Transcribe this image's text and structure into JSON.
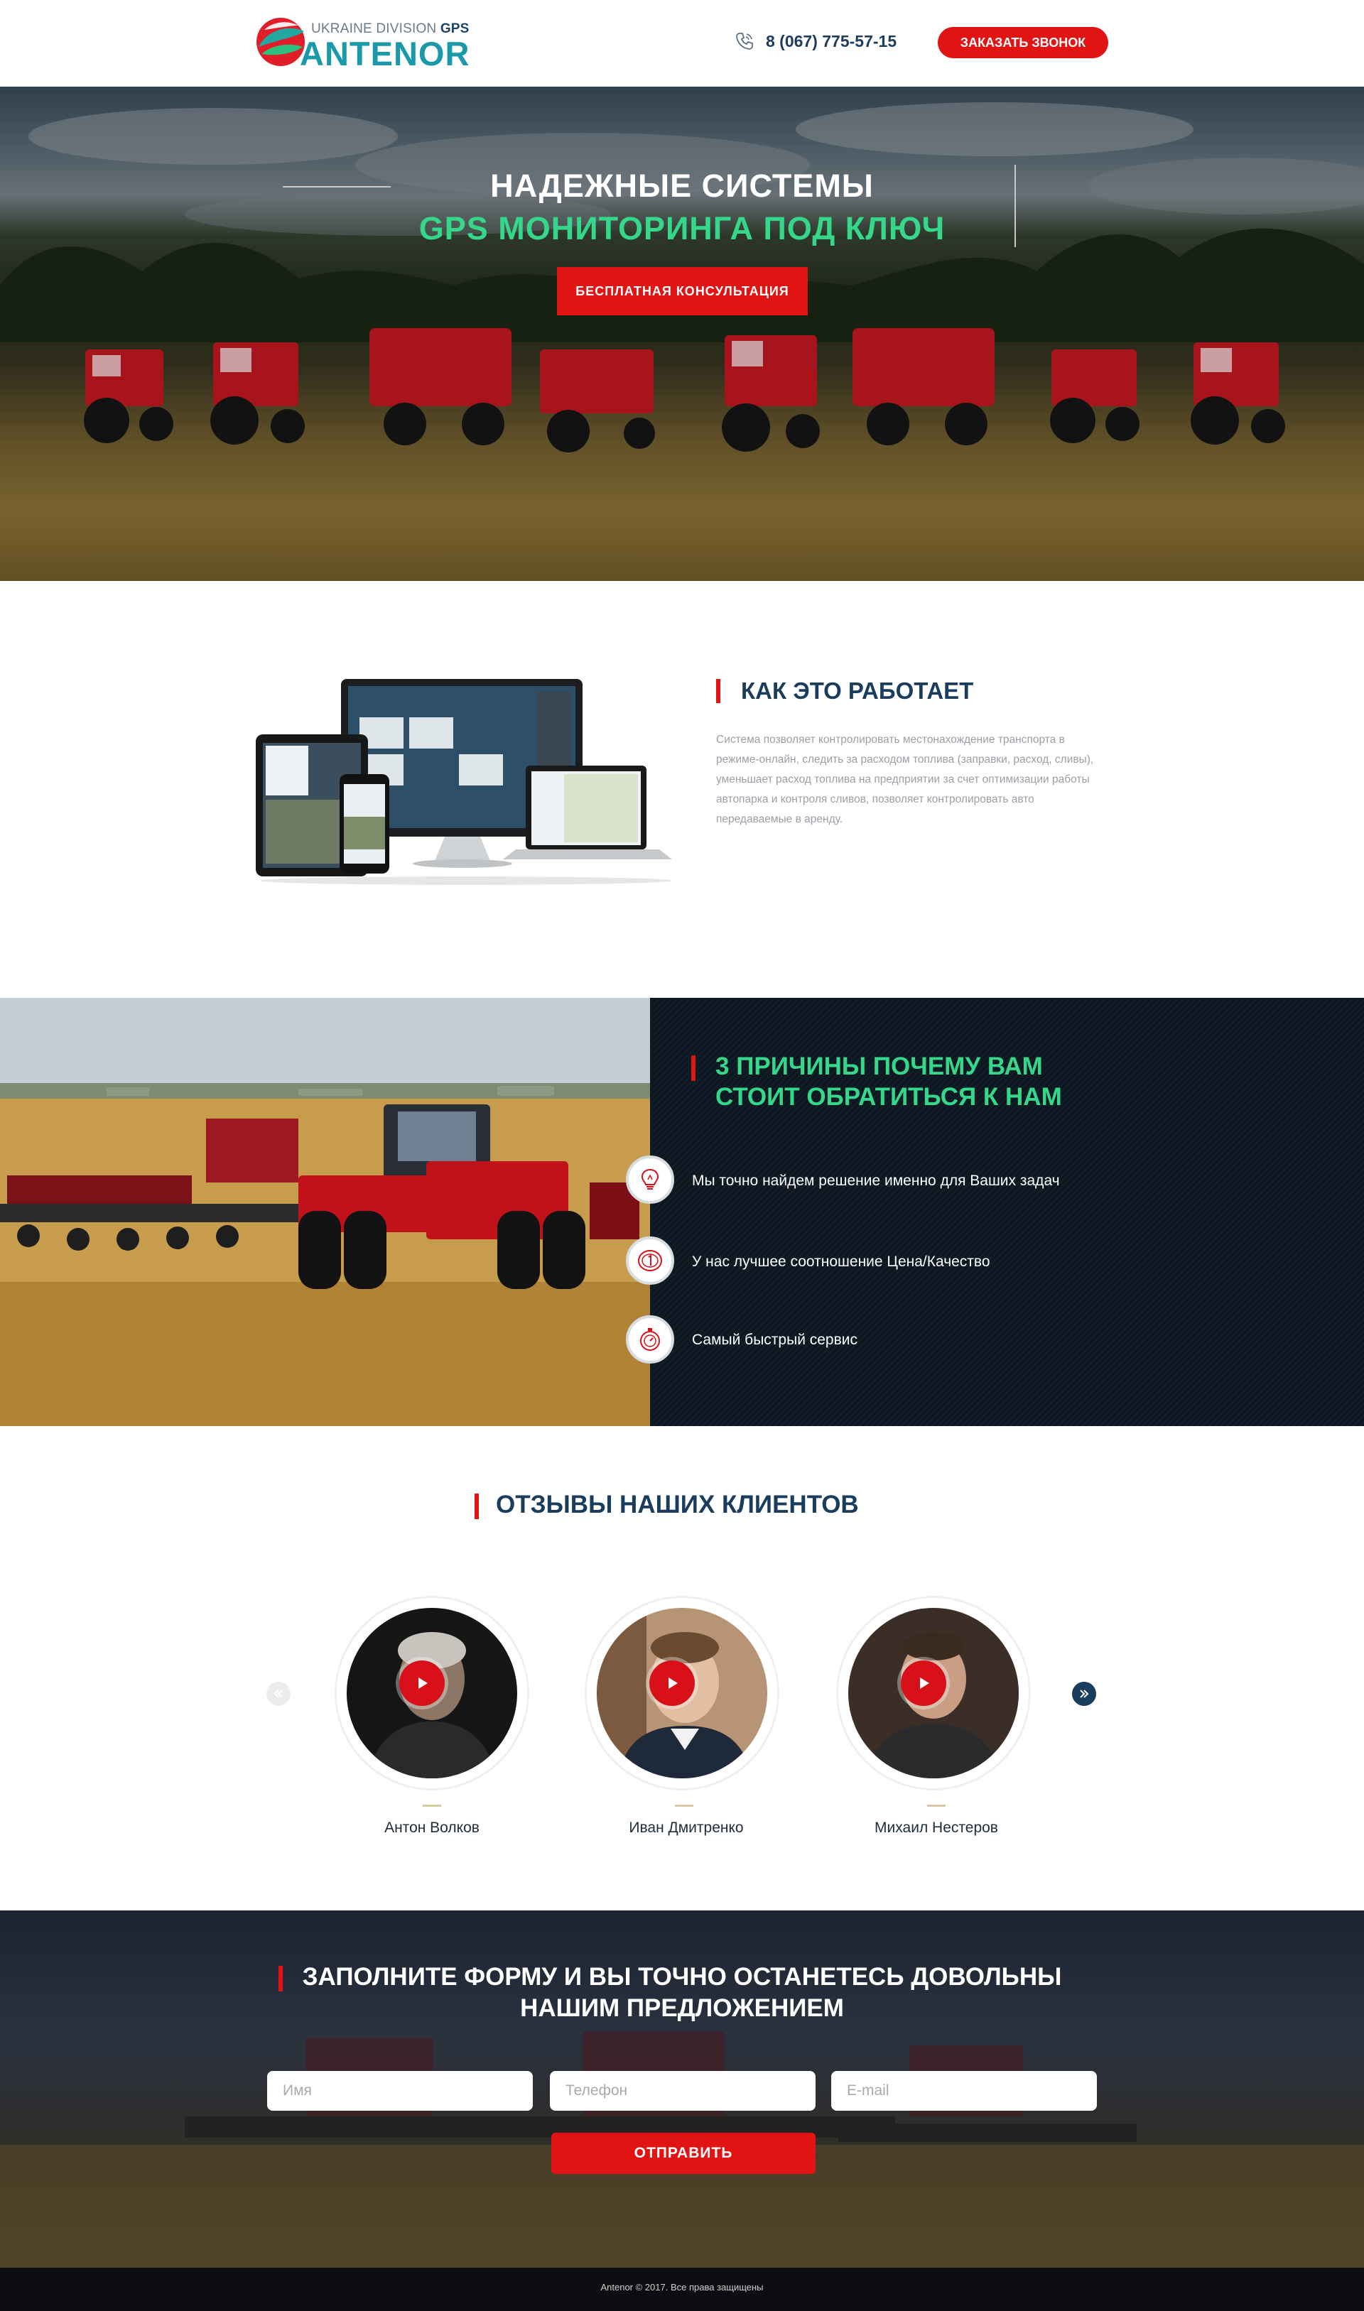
{
  "header": {
    "logo_subtitle_a": "UKRAINE DIVISION",
    "logo_subtitle_b": "GPS",
    "logo_name": "ANTENOR",
    "phone": "8 (067) 775-57-15",
    "call_button": "ЗАКАЗАТЬ ЗВОНОК"
  },
  "hero": {
    "title_line1": "НАДЕЖНЫЕ СИСТЕМЫ",
    "title_line2": "GPS МОНИТОРИНГА ПОД КЛЮЧ",
    "cta": "БЕСПЛАТНАЯ КОНСУЛЬТАЦИЯ"
  },
  "how": {
    "title": "КАК ЭТО РАБОТАЕТ",
    "text": "Система позволяет контролировать местонахождение транспорта в режиме-онлайн, следить за расходом топлива (заправки, расход, сливы), уменьшает расход топлива на предприятии за счет оптимизации работы автопарка и контроля сливов, позволяет контролировать авто передаваемые в аренду."
  },
  "reasons": {
    "title_line1": "3 ПРИЧИНЫ ПОЧЕМУ ВАМ",
    "title_line2": "СТОИТ ОБРАТИТЬСЯ К НАМ",
    "items": [
      {
        "icon": "lightbulb-icon",
        "text": "Мы точно найдем решение именно для Ваших задач"
      },
      {
        "icon": "coin-icon",
        "text": "У нас лучшее соотношение Цена/Качество"
      },
      {
        "icon": "stopwatch-icon",
        "text": "Самый быстрый сервис"
      }
    ]
  },
  "reviews": {
    "title": "ОТЗЫВЫ НАШИХ КЛИЕНТОВ",
    "items": [
      {
        "name": "Антон Волков"
      },
      {
        "name": "Иван Дмитренко"
      },
      {
        "name": "Михаил Нестеров"
      }
    ]
  },
  "form": {
    "title_line1": "ЗАПОЛНИТЕ ФОРМУ И ВЫ ТОЧНО ОСТАНЕТЕСЬ ДОВОЛЬНЫ",
    "title_line2": "НАШИМ ПРЕДЛОЖЕНИЕМ",
    "name_placeholder": "Имя",
    "phone_placeholder": "Телефон",
    "email_placeholder": "E-mail",
    "submit": "ОТПРАВИТЬ"
  },
  "footer": {
    "copyright": "Antenor © 2017. Все права защищены"
  },
  "colors": {
    "accent_red": "#e11313",
    "accent_green": "#35d78a",
    "navy": "#1a3d5e"
  }
}
